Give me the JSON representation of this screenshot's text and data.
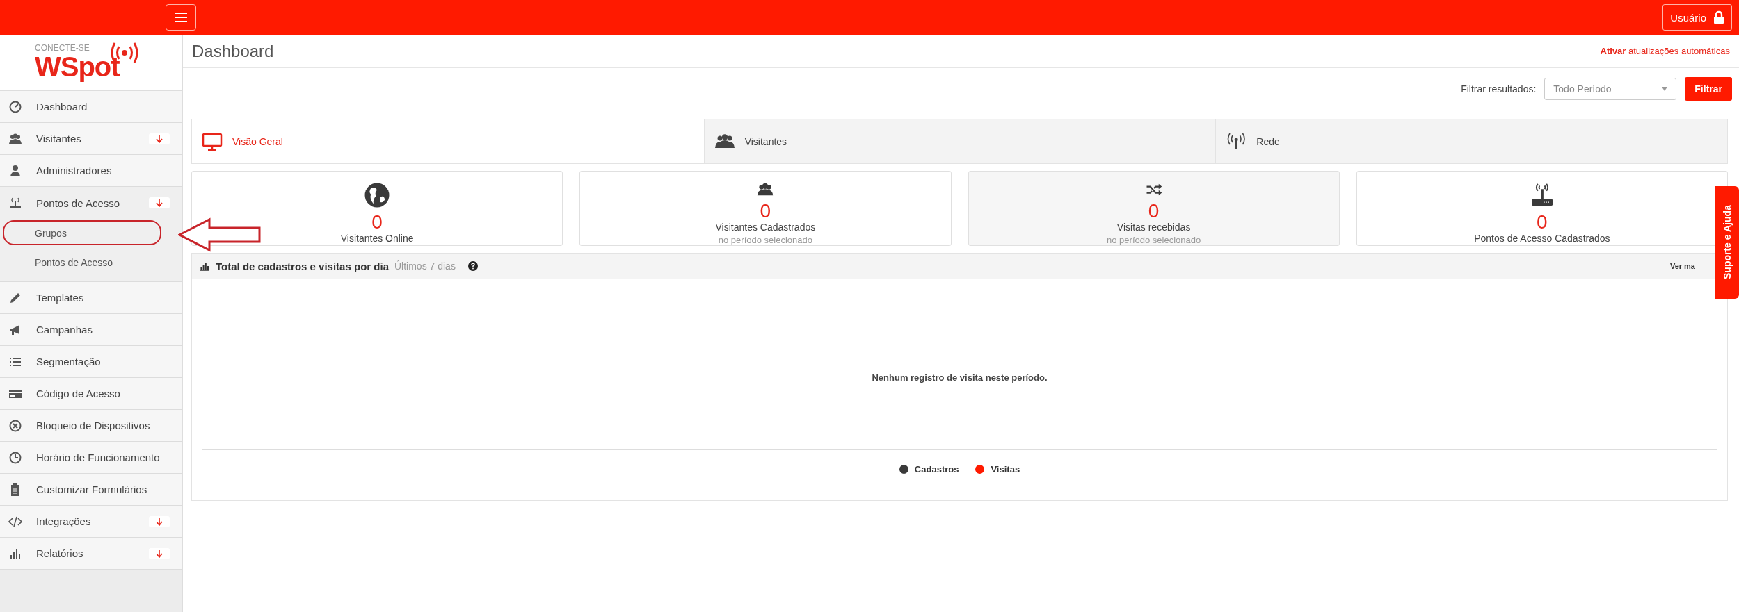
{
  "top_bar": {
    "user_button": "Usuário"
  },
  "logo": {
    "tagline": "CONECTE-SE",
    "name": "WSpot"
  },
  "sidebar": {
    "items": [
      {
        "label": "Dashboard"
      },
      {
        "label": "Visitantes",
        "expanded": false
      },
      {
        "label": "Administradores"
      },
      {
        "label": "Pontos de Acesso",
        "expanded": true,
        "children": [
          {
            "label": "Grupos",
            "highlighted": true
          },
          {
            "label": "Pontos de Acesso",
            "highlighted": false
          }
        ]
      },
      {
        "label": "Templates"
      },
      {
        "label": "Campanhas"
      },
      {
        "label": "Segmentação"
      },
      {
        "label": "Código de Acesso"
      },
      {
        "label": "Bloqueio de Dispositivos"
      },
      {
        "label": "Horário de Funcionamento"
      },
      {
        "label": "Customizar Formulários"
      },
      {
        "label": "Integrações",
        "expanded": false
      },
      {
        "label": "Relatórios",
        "expanded": false
      }
    ]
  },
  "page": {
    "title": "Dashboard",
    "auto_update": "**Ativar** atualizações automáticas"
  },
  "filter": {
    "label": "Filtrar resultados:",
    "value": "Todo Período",
    "button": "Filtrar"
  },
  "tabs": [
    {
      "label": "Visão Geral",
      "selected": true
    },
    {
      "label": "Visitantes",
      "selected": false
    },
    {
      "label": "Rede",
      "selected": false
    }
  ],
  "stats": [
    {
      "value": "0",
      "label": "Visitantes Online"
    },
    {
      "value": "0",
      "label": "Visitantes Cadastrados",
      "note": "no período selecionado"
    },
    {
      "value": "0",
      "label": "Visitas recebidas",
      "note": "no período selecionado"
    },
    {
      "value": "0",
      "label": "Pontos de Acesso Cadastrados"
    }
  ],
  "chart_panel": {
    "title": "Total de cadastros e visitas por dia",
    "subtitle": "Últimos 7 dias",
    "more_link": "Ver ma",
    "empty_message": "Nenhum registro de visita neste período.",
    "legend": [
      {
        "label": "Cadastros",
        "color": "#3a3a3a"
      },
      {
        "label": "Visitas",
        "color": "#ff1a00"
      }
    ]
  },
  "support_tab": "Suporte e Ajuda"
}
